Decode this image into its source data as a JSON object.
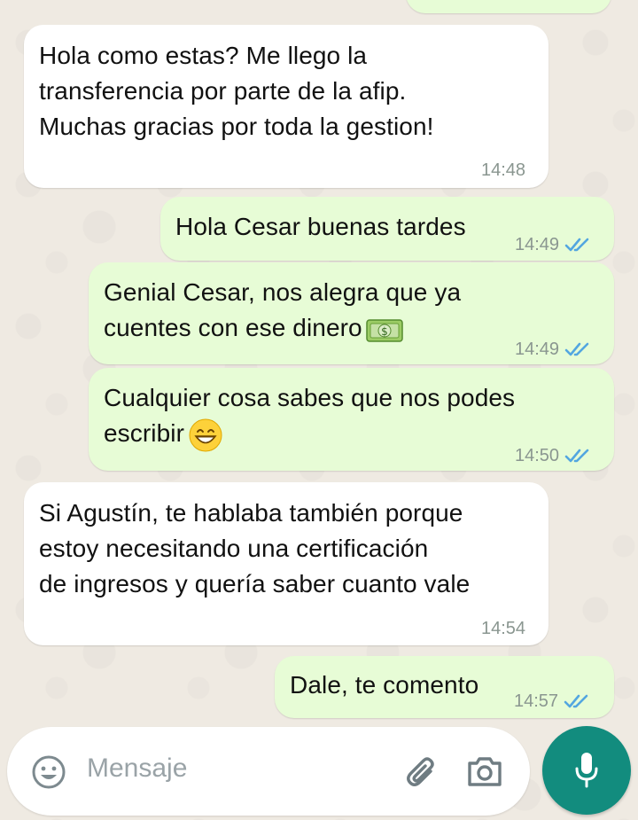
{
  "messages": [
    {
      "direction": "in",
      "text": "Hola como estas? Me llego la\ntransferencia por parte de la afip.\nMuchas gracias por toda la gestion!",
      "time": "14:48"
    },
    {
      "direction": "out",
      "text": "Hola Cesar buenas tardes",
      "time": "14:49",
      "status": "read"
    },
    {
      "direction": "out",
      "text": "Genial Cesar, nos alegra que ya\ncuentes con ese dinero",
      "emoji": "money-emoji",
      "time": "14:49",
      "status": "read"
    },
    {
      "direction": "out",
      "text": "Cualquier cosa sabes que nos podes\nescribir",
      "emoji": "grinning-emoji",
      "time": "14:50",
      "status": "read"
    },
    {
      "direction": "in",
      "text": "Si Agustín, te hablaba también porque\nestoy necesitando una certificación\nde ingresos y quería saber cuanto vale",
      "time": "14:54"
    },
    {
      "direction": "out",
      "text": "Dale, te comento",
      "time": "14:57",
      "status": "read"
    }
  ],
  "input": {
    "placeholder": "Mensaje",
    "icons": [
      "emoji-icon",
      "attach-icon",
      "camera-icon"
    ]
  },
  "mic_button": {
    "icon": "mic-icon"
  },
  "colors": {
    "outgoing_bubble": "#e7fcd6",
    "incoming_bubble": "#ffffff",
    "read_ticks": "#53a6e0",
    "mic_button": "#128c7e",
    "chat_background": "#efeae2"
  }
}
